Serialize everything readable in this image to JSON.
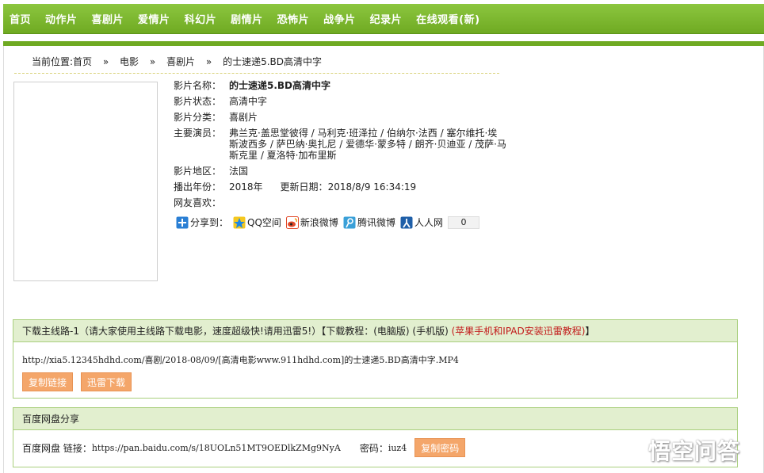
{
  "nav": {
    "items": [
      "首页",
      "动作片",
      "喜剧片",
      "爱情片",
      "科幻片",
      "剧情片",
      "恐怖片",
      "战争片",
      "纪录片",
      "在线观看(新)"
    ]
  },
  "breadcrumb": {
    "prefix": "当前位置:首页",
    "sep": "»",
    "level1": "电影",
    "level2": "喜剧片",
    "level3": "的士速递5.BD高清中字"
  },
  "movie": {
    "labels": {
      "name": "影片名称：",
      "status": "影片状态：",
      "category": "影片分类：",
      "actors": "主要演员：",
      "region": "影片地区：",
      "year": "播出年份：",
      "likes": "网友喜欢："
    },
    "name": "的士速递5.BD高清中字",
    "status": "高清中字",
    "category": "喜剧片",
    "actors": "弗兰克·盖思堂彼得 / 马利克·班泽拉 / 伯纳尔·法西 / 塞尔维托·埃斯波西多 / 萨巴纳·奥扎尼 / 爱德华·蒙多特 / 朗齐·贝迪亚 / 茂萨·马斯克里 / 夏洛特·加布里斯",
    "region": "法国",
    "year": "2018年",
    "update_label": "更新日期：",
    "update": "2018/8/9 16:34:19"
  },
  "share": {
    "label": "分享到：",
    "qzone": "QQ空间",
    "weibo": "新浪微博",
    "tqq": "腾讯微博",
    "renren": "人人网",
    "count": "0"
  },
  "download": {
    "header_main": "下载主线路-1（请大家使用主线路下载电影，速度超级快!请用迅雷5!）【下载教程：(电脑版) (手机版) ",
    "header_red": "(苹果手机和IPAD安装迅雷教程)",
    "header_tail": "】",
    "url": "http://xia5.12345hdhd.com/喜剧/2018-08/09/[高清电影www.911hdhd.com]的士速递5.BD高清中字.MP4",
    "copy_btn": "复制链接",
    "thunder_btn": "迅雷下载"
  },
  "baidu": {
    "header": "百度网盘分享",
    "link_label": "百度网盘 链接：",
    "link": "https://pan.baidu.com/s/18UOLn51MT9OEDlkZMg9NyA",
    "pwd_label": "密码：",
    "pwd": "iuz4",
    "copy_pwd_btn": "复制密码"
  },
  "watermark": {
    "text": "悟空问答",
    "icon": "wukong-logo-icon"
  },
  "colors": {
    "nav_green": "#6faa22",
    "box_header": "#e2efcf",
    "button_orange": "#f4a66a",
    "status_green": "#1d8a1d",
    "tutorial_red": "#c21a1a"
  }
}
